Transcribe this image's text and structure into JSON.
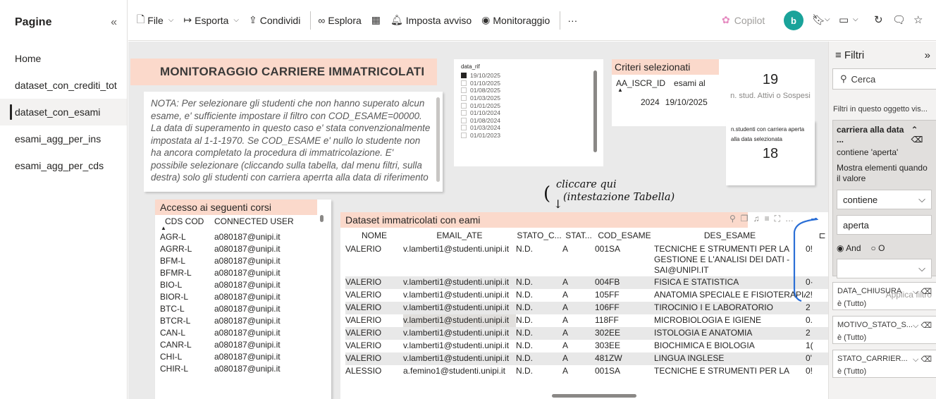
{
  "pages": {
    "title": "Pagine",
    "collapse_icon": "«",
    "items": [
      {
        "label": "Home",
        "active": false
      },
      {
        "label": "dataset_con_crediti_tot",
        "active": false
      },
      {
        "label": "dataset_con_esami",
        "active": true
      },
      {
        "label": "esami_agg_per_ins",
        "active": false
      },
      {
        "label": "esami_agg_per_cds",
        "active": false
      }
    ]
  },
  "toolbar": {
    "file": "File",
    "esporta": "Esporta",
    "condividi": "Condividi",
    "esplora": "Esplora",
    "imposta_avviso": "Imposta avviso",
    "monitoraggio": "Monitoraggio",
    "more": "···",
    "copilot": "Copilot",
    "avatar": "b"
  },
  "canvas": {
    "title": "MONITORAGGIO CARRIERE IMMATRICOLATI",
    "note": "NOTA: Per selezionare gli studenti che non hanno superato alcun esame, e' sufficiente impostare il filtro con COD_ESAME=00000. La data di superamento in questo caso e' stata convenzionalmente impostata al 1-1-1970. Se COD_ESAME e' nullo lo studente non ha ancora completato la procedura di immatricolazione. E' possibile selezionare (cliccando sulla tabella, dal menu filtri, sulla destra) solo gli studenti con carriera aperrta alla data di riferimento",
    "slicer": {
      "label": "data_rif",
      "options": [
        {
          "label": "19/10/2025",
          "checked": true
        },
        {
          "label": "01/10/2025",
          "checked": false
        },
        {
          "label": "01/08/2025",
          "checked": false
        },
        {
          "label": "01/03/2025",
          "checked": false
        },
        {
          "label": "01/01/2025",
          "checked": false
        },
        {
          "label": "01/10/2024",
          "checked": false
        },
        {
          "label": "01/08/2024",
          "checked": false
        },
        {
          "label": "01/03/2024",
          "checked": false
        },
        {
          "label": "01/01/2023",
          "checked": false
        }
      ]
    },
    "criteri": {
      "header": "Criteri selezionati",
      "col1": "AA_ISCR_ID",
      "col2": "esami al",
      "val1": "2024",
      "val2": "19/10/2025"
    },
    "card_active": {
      "value": "19",
      "label": "n. stud. Attivi o Sospesi"
    },
    "card_open": {
      "label1": "n.studenti con carriera aperta",
      "label2": "alla data selezionata",
      "value": "18"
    },
    "corsi": {
      "header": "Accesso ai seguenti corsi",
      "col1": "CDS COD",
      "col2": "CONNECTED USER",
      "rows": [
        {
          "cds": "AGR-L",
          "user": "a080187@unipi.it"
        },
        {
          "cds": "AGRR-L",
          "user": "a080187@unipi.it"
        },
        {
          "cds": "BFM-L",
          "user": "a080187@unipi.it"
        },
        {
          "cds": "BFMR-L",
          "user": "a080187@unipi.it"
        },
        {
          "cds": "BIO-L",
          "user": "a080187@unipi.it"
        },
        {
          "cds": "BIOR-L",
          "user": "a080187@unipi.it"
        },
        {
          "cds": "BTC-L",
          "user": "a080187@unipi.it"
        },
        {
          "cds": "BTCR-L",
          "user": "a080187@unipi.it"
        },
        {
          "cds": "CAN-L",
          "user": "a080187@unipi.it"
        },
        {
          "cds": "CANR-L",
          "user": "a080187@unipi.it"
        },
        {
          "cds": "CHI-L",
          "user": "a080187@unipi.it"
        },
        {
          "cds": "CHIR-L",
          "user": "a080187@unipi.it"
        }
      ]
    },
    "annotation": {
      "line1": "cliccare qui",
      "line2": "(intestazione Tabella)"
    },
    "dataset": {
      "header": "Dataset immatricolati con eami",
      "columns": [
        "NOME",
        "EMAIL_ATE",
        "STATO_C...",
        "STAT...",
        "COD_ESAME",
        "DES_ESAME",
        ""
      ],
      "rows": [
        {
          "nome": "VALERIO",
          "email": "v.lamberti1@studenti.unipi.it",
          "stato_c": "N.D.",
          "stat": "A",
          "cod": "001SA",
          "des": "TECNICHE E STRUMENTI PER LA GESTIONE E L'ANALISI DEI DATI - SAI@UNIPI.IT",
          "extra": "0!"
        },
        {
          "nome": "VALERIO",
          "email": "v.lamberti1@studenti.unipi.it",
          "stato_c": "N.D.",
          "stat": "A",
          "cod": "004FB",
          "des": "FISICA E STATISTICA",
          "extra": "0·"
        },
        {
          "nome": "VALERIO",
          "email": "v.lamberti1@studenti.unipi.it",
          "stato_c": "N.D.",
          "stat": "A",
          "cod": "105FF",
          "des": "ANATOMIA SPECIALE E FISIOTERAPIA",
          "extra": "2!"
        },
        {
          "nome": "VALERIO",
          "email": "v.lamberti1@studenti.unipi.it",
          "stato_c": "N.D.",
          "stat": "A",
          "cod": "106FF",
          "des": "TIROCINIO I E LABORATORIO",
          "extra": "2"
        },
        {
          "nome": "VALERIO",
          "email": "v.lamberti1@studenti.unipi.it",
          "stato_c": "N.D.",
          "stat": "A",
          "cod": "118FF",
          "des": "MICROBIOLOGIA E IGIENE",
          "extra": "0."
        },
        {
          "nome": "VALERIO",
          "email": "v.lamberti1@studenti.unipi.it",
          "stato_c": "N.D.",
          "stat": "A",
          "cod": "302EE",
          "des": "ISTOLOGIA E ANATOMIA",
          "extra": "2"
        },
        {
          "nome": "VALERIO",
          "email": "v.lamberti1@studenti.unipi.it",
          "stato_c": "N.D.",
          "stat": "A",
          "cod": "303EE",
          "des": "BIOCHIMICA E BIOLOGIA",
          "extra": "1("
        },
        {
          "nome": "VALERIO",
          "email": "v.lamberti1@studenti.unipi.it",
          "stato_c": "N.D.",
          "stat": "A",
          "cod": "481ZW",
          "des": "LINGUA INGLESE",
          "extra": "0'"
        },
        {
          "nome": "ALESSIO",
          "email": "a.femino1@studenti.unipi.it",
          "stato_c": "N.D.",
          "stat": "A",
          "cod": "001SA",
          "des": "TECNICHE E STRUMENTI PER LA",
          "extra": "0!"
        }
      ]
    }
  },
  "filters": {
    "title": "Filtri",
    "search_placeholder": "Cerca",
    "section": "Filtri in questo oggetto vis...",
    "active": {
      "name": "carriera alla data ...",
      "summary": "contiene 'aperta'",
      "desc": "Mostra elementi quando il valore",
      "operator": "contiene",
      "value": "aperta",
      "and": "And",
      "or": "O",
      "apply": "Applica filtro"
    },
    "others": [
      {
        "name": "DATA_CHIUSURA",
        "value": "è (Tutto)"
      },
      {
        "name": "MOTIVO_STATO_S...",
        "value": "è (Tutto)"
      },
      {
        "name": "STATO_CARRIER...",
        "value": "è (Tutto)"
      }
    ]
  }
}
